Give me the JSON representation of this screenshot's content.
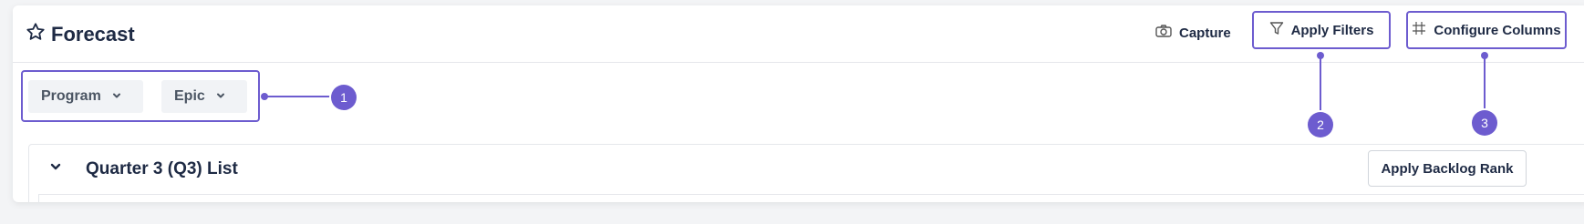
{
  "header": {
    "title": "Forecast",
    "capture_label": "Capture",
    "apply_filters_label": "Apply Filters",
    "configure_columns_label": "Configure Columns"
  },
  "selectors": {
    "program_label": "Program",
    "epic_label": "Epic"
  },
  "callouts": {
    "one": "1",
    "two": "2",
    "three": "3"
  },
  "list": {
    "title": "Quarter 3 (Q3) List",
    "apply_backlog_rank_label": "Apply Backlog Rank"
  },
  "colors": {
    "accent": "#6d5ccf",
    "text": "#1e2a44"
  }
}
